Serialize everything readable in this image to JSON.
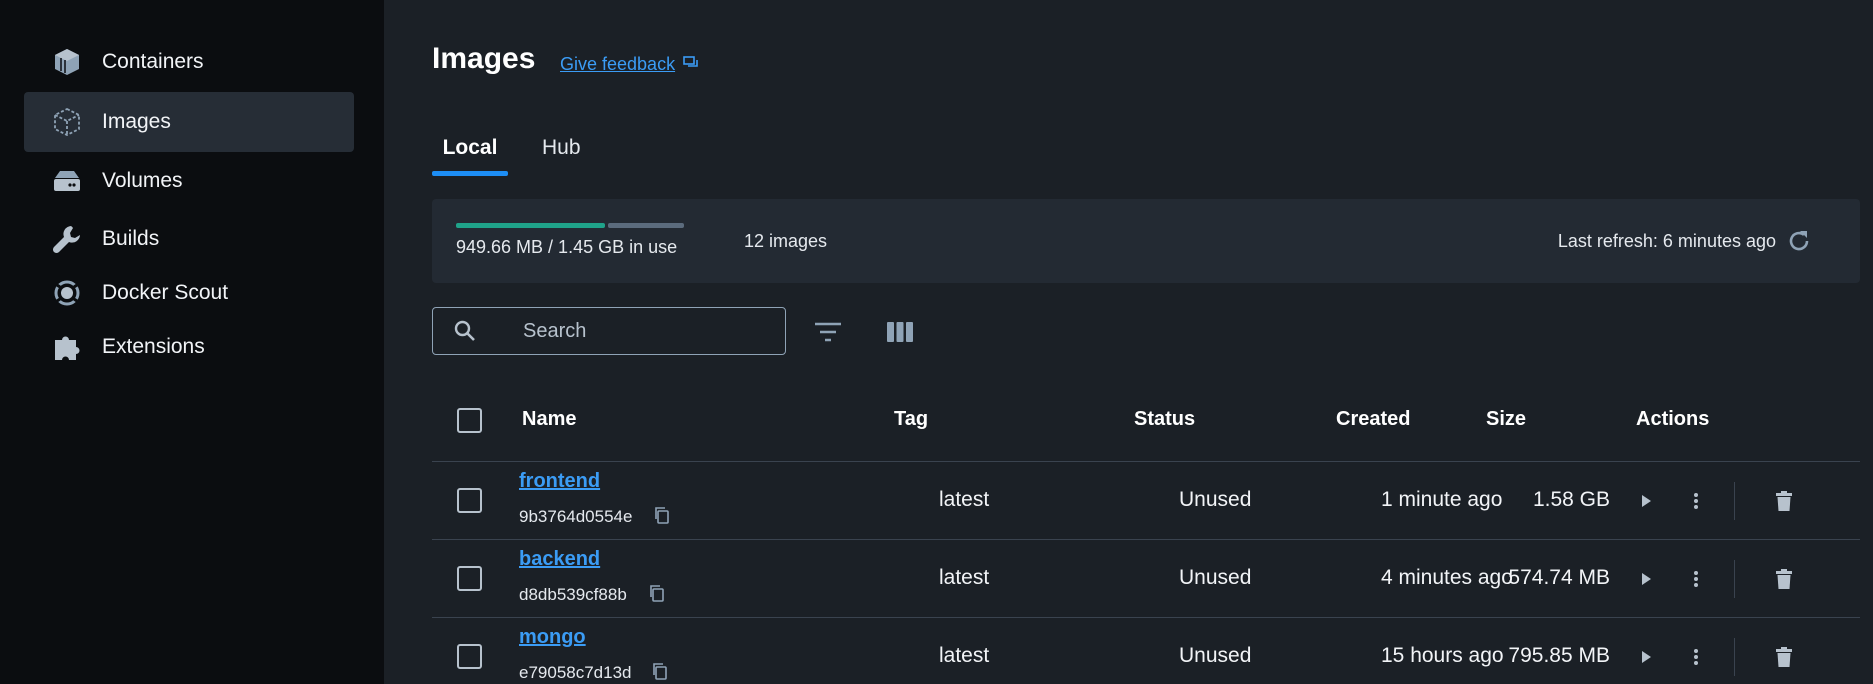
{
  "sidebar": {
    "items": [
      {
        "label": "Containers",
        "icon": "container-icon"
      },
      {
        "label": "Images",
        "icon": "image-icon",
        "active": true
      },
      {
        "label": "Volumes",
        "icon": "volume-icon"
      },
      {
        "label": "Builds",
        "icon": "wrench-icon"
      },
      {
        "label": "Docker Scout",
        "icon": "scout-icon"
      },
      {
        "label": "Extensions",
        "icon": "puzzle-icon"
      }
    ]
  },
  "header": {
    "title": "Images",
    "feedback_label": "Give feedback"
  },
  "tabs": [
    {
      "label": "Local",
      "active": true
    },
    {
      "label": "Hub",
      "active": false
    }
  ],
  "usage": {
    "text": "949.66 MB / 1.45 GB in use",
    "used_fraction": 0.655,
    "image_count": "12 images",
    "last_refresh": "Last refresh: 6 minutes ago"
  },
  "search": {
    "placeholder": "Search",
    "value": ""
  },
  "table": {
    "headers": {
      "name": "Name",
      "tag": "Tag",
      "status": "Status",
      "created": "Created",
      "size": "Size",
      "actions": "Actions"
    },
    "rows": [
      {
        "name": "frontend",
        "id": "9b3764d0554e",
        "tag": "latest",
        "status": "Unused",
        "created": "1 minute ago",
        "size": "1.58 GB"
      },
      {
        "name": "backend",
        "id": "d8db539cf88b",
        "tag": "latest",
        "status": "Unused",
        "created": "4 minutes ago",
        "size": "574.74 MB"
      },
      {
        "name": "mongo",
        "id": "e79058c7d13d",
        "tag": "latest",
        "status": "Unused",
        "created": "15 hours ago",
        "size": "795.85 MB"
      }
    ]
  },
  "colors": {
    "accent": "#1d8ef5",
    "link": "#3b9cf5",
    "usage_used": "#1fa38a",
    "usage_free": "#5b6b7d",
    "sidebar_bg": "#0b0d10",
    "main_bg": "#1b2026"
  }
}
